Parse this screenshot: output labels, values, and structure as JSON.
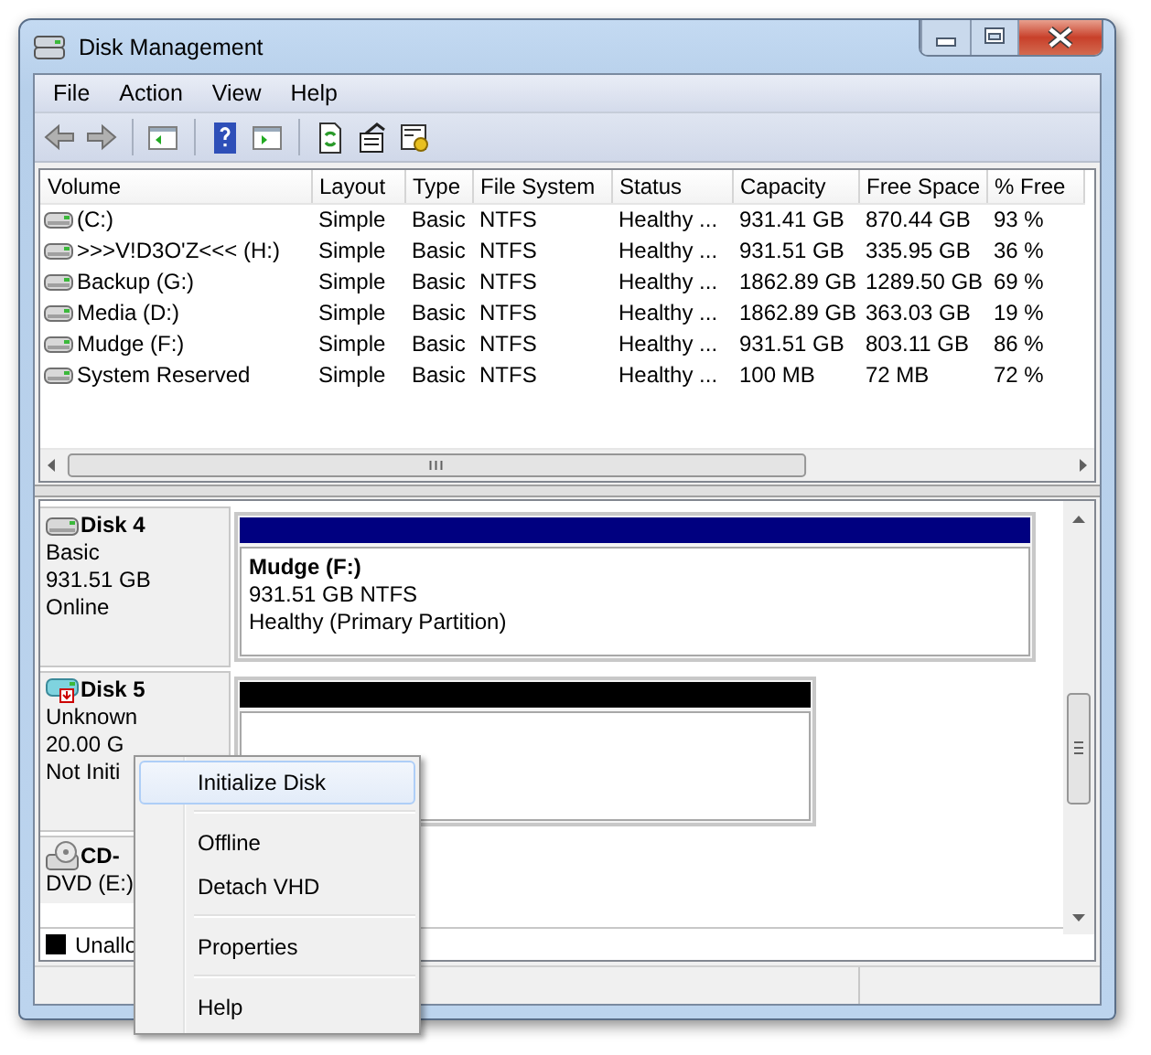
{
  "window": {
    "title": "Disk Management"
  },
  "menu_bar": [
    "File",
    "Action",
    "View",
    "Help"
  ],
  "volume_table": {
    "columns": [
      "Volume",
      "Layout",
      "Type",
      "File System",
      "Status",
      "Capacity",
      "Free Space",
      "% Free"
    ],
    "rows": [
      [
        " (C:)",
        "Simple",
        "Basic",
        "NTFS",
        "Healthy ...",
        "931.41 GB",
        "870.44 GB",
        "93 %"
      ],
      [
        ">>>V!D3O'Z<<< (H:)",
        "Simple",
        "Basic",
        "NTFS",
        "Healthy ...",
        "931.51 GB",
        "335.95 GB",
        "36 %"
      ],
      [
        "Backup  (G:)",
        "Simple",
        "Basic",
        "NTFS",
        "Healthy ...",
        "1862.89 GB",
        "1289.50 GB",
        "69 %"
      ],
      [
        "Media (D:)",
        "Simple",
        "Basic",
        "NTFS",
        "Healthy ...",
        "1862.89 GB",
        "363.03 GB",
        "19 %"
      ],
      [
        "Mudge (F:)",
        "Simple",
        "Basic",
        "NTFS",
        "Healthy ...",
        "931.51 GB",
        "803.11 GB",
        "86 %"
      ],
      [
        "System Reserved",
        "Simple",
        "Basic",
        "NTFS",
        "Healthy ...",
        "100 MB",
        "72 MB",
        "72 %"
      ]
    ]
  },
  "disks": [
    {
      "kind": "basic",
      "name": "Disk 4",
      "lines": [
        "Basic",
        "931.51 GB",
        "Online"
      ],
      "partitions": [
        {
          "color": "#000080",
          "title": "Mudge  (F:)",
          "lines": [
            "931.51 GB NTFS",
            "Healthy (Primary Partition)"
          ]
        }
      ]
    },
    {
      "kind": "unknown",
      "name": "Disk 5",
      "lines": [
        "Unknown",
        "20.00 G",
        "Not Initi"
      ],
      "partitions": [
        {
          "color": "#000000"
        }
      ]
    },
    {
      "kind": "cdrom",
      "name": "CD-",
      "lines": [
        "DVD (E:)"
      ]
    }
  ],
  "legend": [
    {
      "color": "#000000",
      "label": "Unallo"
    }
  ],
  "context_menu": {
    "groups": [
      [
        {
          "label": "Initialize Disk",
          "selected": true
        }
      ],
      [
        {
          "label": "Offline",
          "selected": false
        },
        {
          "label": "Detach VHD",
          "selected": false
        }
      ],
      [
        {
          "label": "Properties",
          "selected": false
        }
      ],
      [
        {
          "label": "Help",
          "selected": false
        }
      ]
    ]
  }
}
